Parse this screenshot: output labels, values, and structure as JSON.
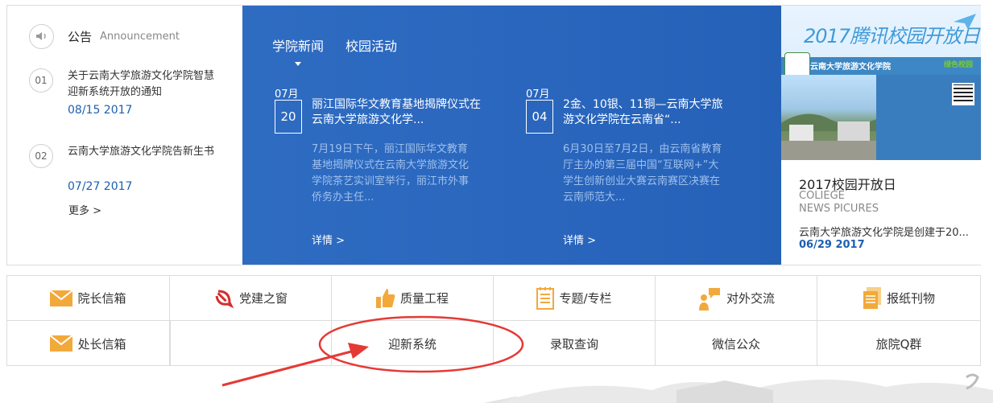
{
  "announcement": {
    "title": "公告",
    "subtitle": "Announcement",
    "items": [
      {
        "num": "01",
        "text": "关于云南大学旅游文化学院智慧迎新系统开放的通知",
        "date": "08/15 2017"
      },
      {
        "num": "02",
        "text": "云南大学旅游文化学院告新生书",
        "date": "07/27 2017"
      }
    ],
    "more": "更多 >"
  },
  "news": {
    "tabs": [
      "学院新闻",
      "校园活动"
    ],
    "cards": [
      {
        "month": "07月",
        "day": "20",
        "title": "丽江国际华文教育基地揭牌仪式在云南大学旅游文化学...",
        "body": "7月19日下午，丽江国际华文教育基地揭牌仪式在云南大学旅游文化学院茶艺实训室举行，丽江市外事侨务办主任...",
        "more": "详情 >"
      },
      {
        "month": "07月",
        "day": "04",
        "title": "2金、10银、11铜—云南大学旅游文化学院在云南省“...",
        "body": "6月30日至7月2日，由云南省教育厅主办的第三届中国“互联网+”大学生创新创业大赛云南赛区决赛在云南师范大...",
        "more": "详情 >"
      }
    ]
  },
  "feature": {
    "poster_title": "2017腾讯校园开放日",
    "poster_school": "云南大学旅游文化学院",
    "poster_tag": "绿色校园",
    "title": "2017校园开放日",
    "en1": "COLIEGE",
    "en2": "NEWS PICURES",
    "desc": "云南大学旅游文化学院是创建于20...",
    "date": "06/29 2017"
  },
  "links": {
    "row1": [
      {
        "label": "院长信箱",
        "icon": "envelope-icon"
      },
      {
        "label": "党建之窗",
        "icon": "hammer-sickle-icon"
      },
      {
        "label": "质量工程",
        "icon": "thumbs-up-icon"
      },
      {
        "label": "专题/专栏",
        "icon": "notepad-icon"
      },
      {
        "label": "对外交流",
        "icon": "chat-person-icon"
      },
      {
        "label": "报纸刊物",
        "icon": "newspaper-icon"
      }
    ],
    "row2": [
      {
        "label": "处长信箱",
        "icon": "envelope-icon"
      },
      {
        "label": ""
      },
      {
        "label": "迎新系统"
      },
      {
        "label": "录取查询"
      },
      {
        "label": "微信公众"
      },
      {
        "label": "旅院Q群"
      }
    ]
  },
  "colors": {
    "news_bg": "#2a66bd",
    "accent_blue": "#1d5fb0",
    "highlight_red": "#e53935",
    "icon_orange": "#f2a93b"
  }
}
